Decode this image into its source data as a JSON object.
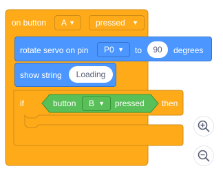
{
  "hat_block": {
    "prefix": "on button",
    "button_value": "A",
    "event_value": "pressed"
  },
  "servo_block": {
    "prefix": "rotate servo on pin",
    "pin_value": "P0",
    "to_text": "to",
    "angle_value": "90",
    "unit_text": "degrees"
  },
  "show_string_block": {
    "prefix": "show string",
    "value": "Loading"
  },
  "if_block": {
    "if_text": "if",
    "condition_prefix": "button",
    "condition_button": "B",
    "condition_suffix": "pressed",
    "then_text": "then"
  },
  "zoom_controls": {
    "zoom_in_icon": "zoom-in-icon",
    "zoom_out_icon": "zoom-out-icon"
  },
  "colors": {
    "events": "#ffab19",
    "actions": "#4c97ff",
    "sensing": "#59c059"
  }
}
